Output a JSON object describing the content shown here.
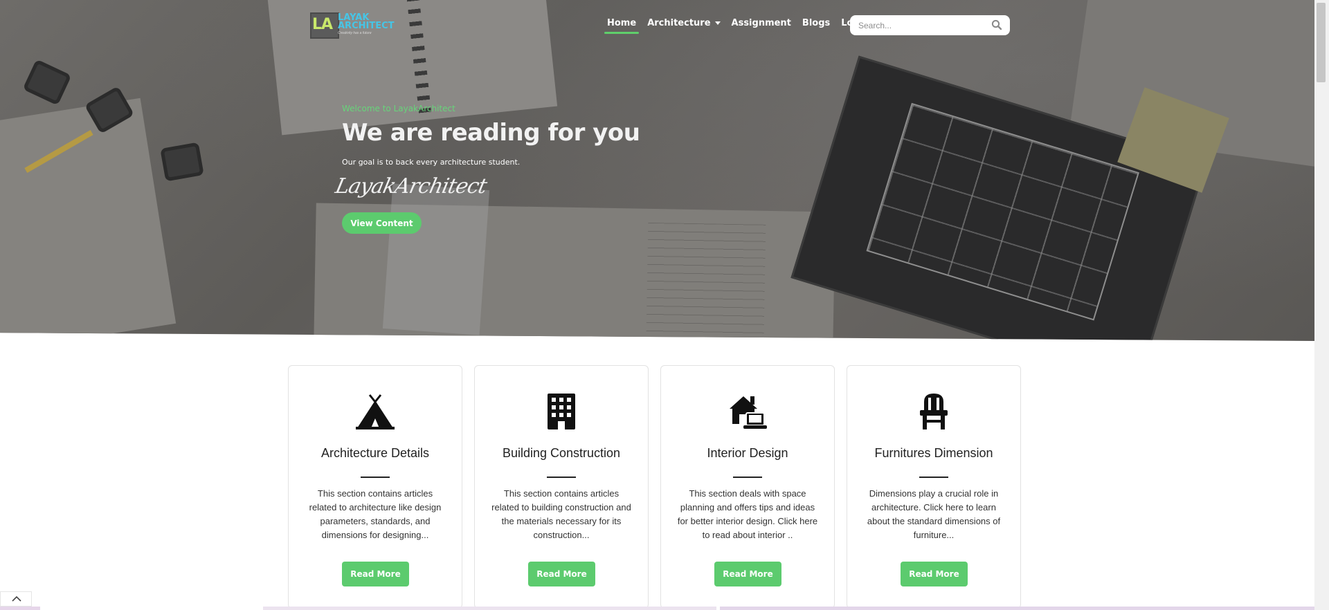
{
  "brand": {
    "logo_initials": "LA",
    "logo_name": "Layak Architect",
    "logo_tagline": "Creativity has a future"
  },
  "nav": {
    "items": [
      {
        "label": "Home",
        "active": true
      },
      {
        "label": "Architecture",
        "has_dropdown": true
      },
      {
        "label": "Assignment"
      },
      {
        "label": "Blogs"
      },
      {
        "label": "Login"
      }
    ]
  },
  "search": {
    "placeholder": "Search...",
    "value": "",
    "icon": "search-icon"
  },
  "hero": {
    "welcome": "Welcome to LayakArchitect",
    "headline": "We are reading for you",
    "subtext": "Our goal is to back every architecture student.",
    "signature": "LayakArchitect",
    "cta_label": "View Content"
  },
  "cards": [
    {
      "icon": "tent-icon",
      "title": "Architecture Details",
      "text": "This section contains articles related to architecture like design parameters, standards, and dimensions for designing...",
      "button_label": "Read More"
    },
    {
      "icon": "building-icon",
      "title": "Building Construction",
      "text": "This section contains articles related to building construction and the materials necessary for its construction...",
      "button_label": "Read More"
    },
    {
      "icon": "house-laptop-icon",
      "title": "Interior Design",
      "text": "This section deals with space planning and offers tips and ideas for better interior design. Click here to read about interior ..",
      "button_label": "Read More"
    },
    {
      "icon": "chair-icon",
      "title": "Furnitures Dimension",
      "text": "Dimensions play a crucial role in architecture. Click here to learn about the standard dimensions of furniture...",
      "button_label": "Read More"
    }
  ],
  "colors": {
    "accent": "#5ccb6e",
    "welcome_text": "#67d47a",
    "logo_blue": "#46c5e6",
    "logo_green": "#c9e86b"
  }
}
